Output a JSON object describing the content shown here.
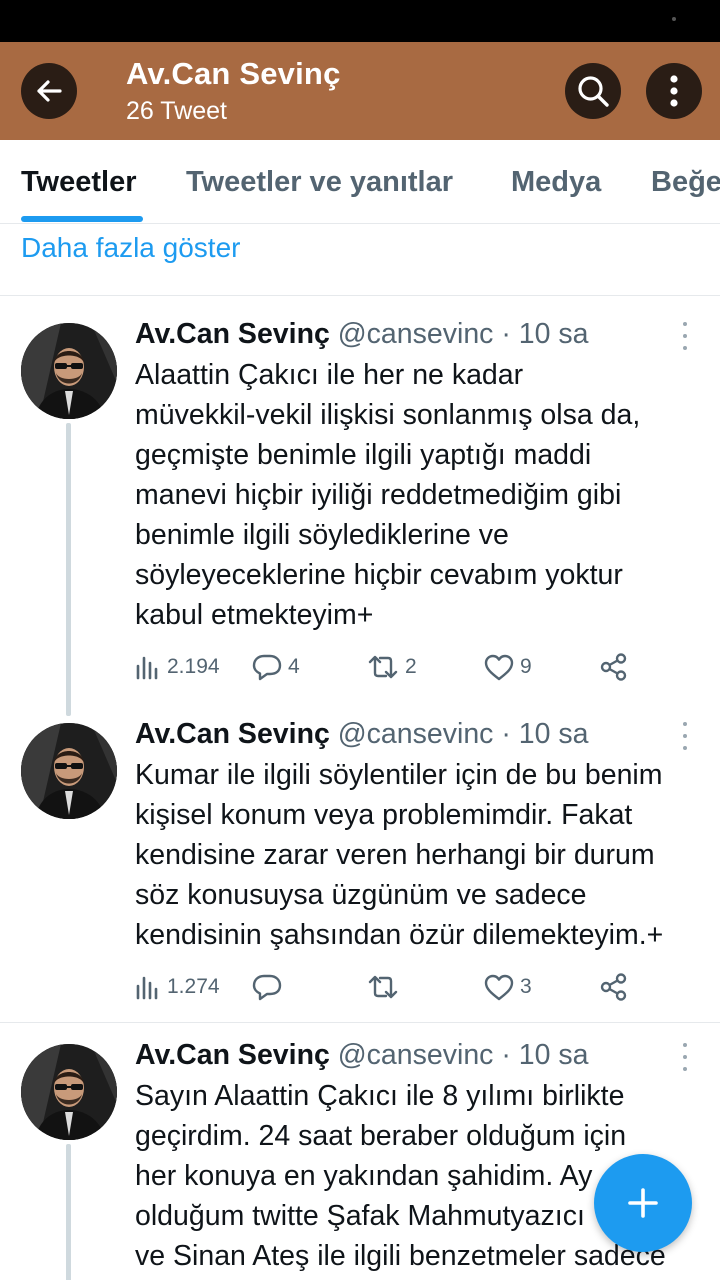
{
  "header": {
    "title": "Av.Can Sevinç",
    "subtitle": "26 Tweet"
  },
  "tabs": [
    {
      "label": "Tweetler",
      "active": true
    },
    {
      "label": "Tweetler ve yanıtlar",
      "active": false
    },
    {
      "label": "Medya",
      "active": false
    },
    {
      "label": "Beğe",
      "active": false
    }
  ],
  "show_more": "Daha fazla göster",
  "tweets": [
    {
      "name": "Av.Can Sevinç",
      "handle": "@cansevinc",
      "separator": " · ",
      "time": "10 sa",
      "lines": [
        "Alaattin Çakıcı ile her ne kadar",
        "müvekkil-vekil ilişkisi sonlanmış olsa da,",
        "geçmişte benimle ilgili yaptığı maddi",
        "manevi hiçbir iyiliği reddetmediğim gibi",
        "benimle ilgili söylediklerine ve",
        "söyleyeceklerine hiçbir cevabım yoktur",
        "kabul etmekteyim+"
      ],
      "views": "2.194",
      "replies": "4",
      "retweets": "2",
      "likes": "9"
    },
    {
      "name": "Av.Can Sevinç",
      "handle": "@cansevinc",
      "separator": " · ",
      "time": "10 sa",
      "lines": [
        "Kumar ile ilgili söylentiler için de bu benim",
        "kişisel konum veya problemimdir. Fakat",
        "kendisine zarar veren herhangi bir durum",
        "söz konusuysa üzgünüm ve sadece",
        "kendisinin şahsından özür dilemekteyim.+"
      ],
      "views": "1.274",
      "replies": "",
      "retweets": "",
      "likes": "3"
    },
    {
      "name": "Av.Can Sevinç",
      "handle": "@cansevinc",
      "separator": " · ",
      "time": "10 sa",
      "lines": [
        "Sayın Alaattin Çakıcı ile 8 yılımı birlikte",
        "geçirdim. 24 saat beraber olduğum için",
        "her konuya en yakından şahidim. Ay",
        "olduğum twitte Şafak Mahmutyazıcı",
        "ve Sinan Ateş ile ilgili benzetmeler sadece"
      ]
    }
  ],
  "icons": {
    "back": "arrow-left-icon",
    "search": "search-icon",
    "more": "more-vertical-icon",
    "views": "bar-chart-icon",
    "reply": "speech-bubble-icon",
    "retweet": "retweet-icon",
    "like": "heart-icon",
    "share": "share-icon",
    "compose": "plus-icon"
  },
  "colors": {
    "header_bg": "#a86a42",
    "accent": "#1d9bf0",
    "muted": "#536471"
  }
}
